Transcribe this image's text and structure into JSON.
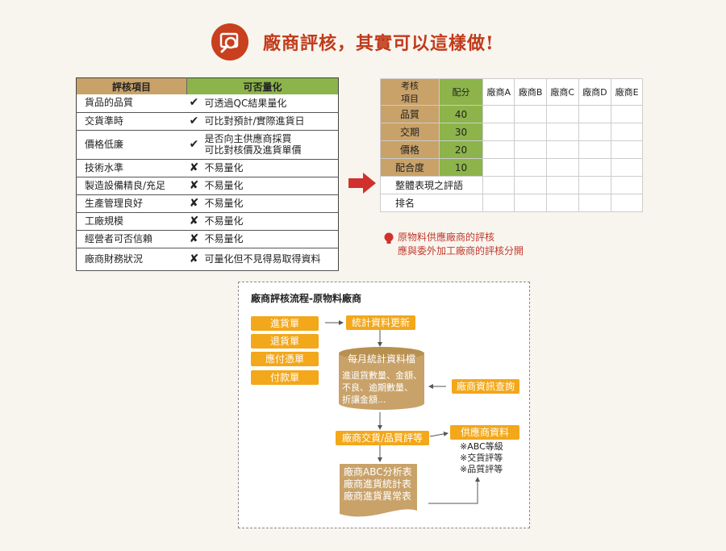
{
  "header": {
    "title": "廠商評核，其實可以這樣做!"
  },
  "left_table": {
    "headers": [
      "評核項目",
      "可否量化"
    ],
    "rows": [
      {
        "item": "貨品的品質",
        "mark": "✔",
        "desc": [
          "可透過QC結果量化"
        ]
      },
      {
        "item": "交貨準時",
        "mark": "✔",
        "desc": [
          "可比對預計/實際進貨日"
        ]
      },
      {
        "item": "價格低廉",
        "mark": "✔",
        "desc": [
          "是否向主供應商採買",
          "可比對核價及進貨單價"
        ]
      },
      {
        "item": "技術水準",
        "mark": "✘",
        "desc": [
          "不易量化"
        ]
      },
      {
        "item": "製造設備精良/充足",
        "mark": "✘",
        "desc": [
          "不易量化"
        ]
      },
      {
        "item": "生產管理良好",
        "mark": "✘",
        "desc": [
          "不易量化"
        ]
      },
      {
        "item": "工廠規模",
        "mark": "✘",
        "desc": [
          "不易量化"
        ]
      },
      {
        "item": "經營者可否信賴",
        "mark": "✘",
        "desc": [
          "不易量化"
        ]
      },
      {
        "item": "廠商財務狀況",
        "mark": "✘",
        "desc": [
          "可量化但不見得易取得資料"
        ]
      }
    ]
  },
  "right_table": {
    "header_item": [
      "考核",
      "項目"
    ],
    "header_score": "配分",
    "vendors": [
      "廠商A",
      "廠商B",
      "廠商C",
      "廠商D",
      "廠商E"
    ],
    "rows": [
      {
        "item": "品質",
        "score": "40"
      },
      {
        "item": "交期",
        "score": "30"
      },
      {
        "item": "價格",
        "score": "20"
      },
      {
        "item": "配合度",
        "score": "10"
      }
    ],
    "extra_rows": [
      "整體表現之評語",
      "排名"
    ]
  },
  "note": [
    "原物料供應廠商的評核",
    "應與委外加工廠商的評核分開"
  ],
  "flow": {
    "title": "廠商評核流程-原物料廠商",
    "inputs": [
      "進貨單",
      "退貨單",
      "應付憑單",
      "付款單"
    ],
    "update": "統計資料更新",
    "db_title": "每月統計資料檔",
    "db_lines": [
      "進退貨數量、金額、",
      "不良、逾期數量、",
      "折讓金額..."
    ],
    "query": "廠商資訊查詢",
    "grading": "廠商交貨/品質評等",
    "vendor_data": "供應商資料",
    "vendor_notes": [
      "※ABC等級",
      "※交貨評等",
      "※品質評等"
    ],
    "reports": [
      "廠商ABC分析表",
      "廠商進貨統計表",
      "廠商進貨異常表"
    ]
  },
  "colors": {
    "accent": "#c8401e",
    "tan": "#c9a269",
    "green": "#8cb44a",
    "orange": "#f3a71a",
    "red": "#d0312d"
  }
}
